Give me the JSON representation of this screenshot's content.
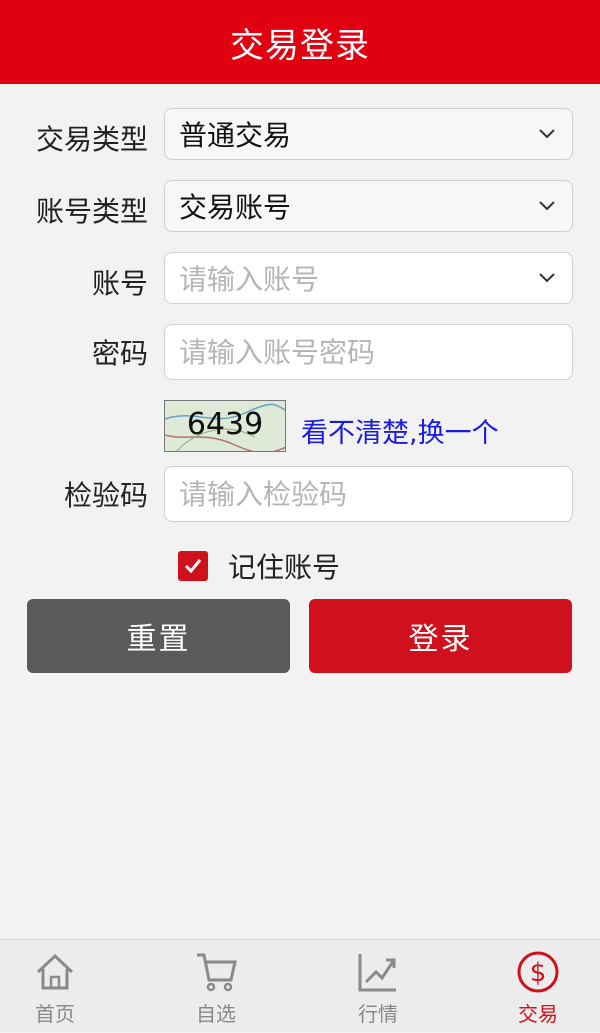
{
  "header": {
    "title": "交易登录"
  },
  "form": {
    "trade_type": {
      "label": "交易类型",
      "value": "普通交易"
    },
    "account_type": {
      "label": "账号类型",
      "value": "交易账号"
    },
    "account": {
      "label": "账号",
      "placeholder": "请输入账号"
    },
    "password": {
      "label": "密码",
      "placeholder": "请输入账号密码"
    },
    "captcha": {
      "code": "6439",
      "refresh_label": "看不清楚,换一个"
    },
    "verify_code": {
      "label": "检验码",
      "placeholder": "请输入检验码"
    },
    "remember": {
      "label": "记住账号",
      "checked": true
    }
  },
  "buttons": {
    "reset": "重置",
    "login": "登录"
  },
  "tabbar": {
    "items": [
      {
        "label": "首页",
        "icon": "home-icon"
      },
      {
        "label": "自选",
        "icon": "cart-icon"
      },
      {
        "label": "行情",
        "icon": "chart-icon"
      },
      {
        "label": "交易",
        "icon": "dollar-icon",
        "active": true
      }
    ]
  },
  "colors": {
    "brand": "#e1000f",
    "button_red": "#d0101c",
    "button_gray": "#5a5a5a",
    "link": "#1a1ae6"
  }
}
